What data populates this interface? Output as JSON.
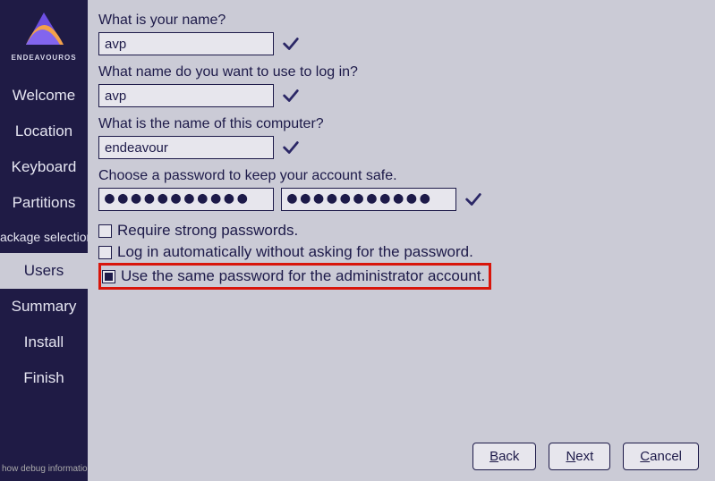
{
  "brand": "ENDEAVOUROS",
  "sidebar": {
    "items": [
      {
        "label": "Welcome"
      },
      {
        "label": "Location"
      },
      {
        "label": "Keyboard"
      },
      {
        "label": "Partitions"
      },
      {
        "label": "ackage selection"
      },
      {
        "label": "Users"
      },
      {
        "label": "Summary"
      },
      {
        "label": "Install"
      },
      {
        "label": "Finish"
      }
    ],
    "debug": "how debug information"
  },
  "form": {
    "name_label": "What is your name?",
    "name_value": "avp",
    "login_label": "What name do you want to use to log in?",
    "login_value": "avp",
    "host_label": "What is the name of this computer?",
    "host_value": "endeavour",
    "pw_label": "Choose a password to keep your account safe.",
    "pw1": "●●●●●●●●●●●",
    "pw2": "●●●●●●●●●●●",
    "cb_strong": "Require strong passwords.",
    "cb_autologin": "Log in automatically without asking for the password.",
    "cb_samepw": "Use the same password for the administrator account."
  },
  "buttons": {
    "back": "Back",
    "next": "Next",
    "cancel": "Cancel"
  }
}
